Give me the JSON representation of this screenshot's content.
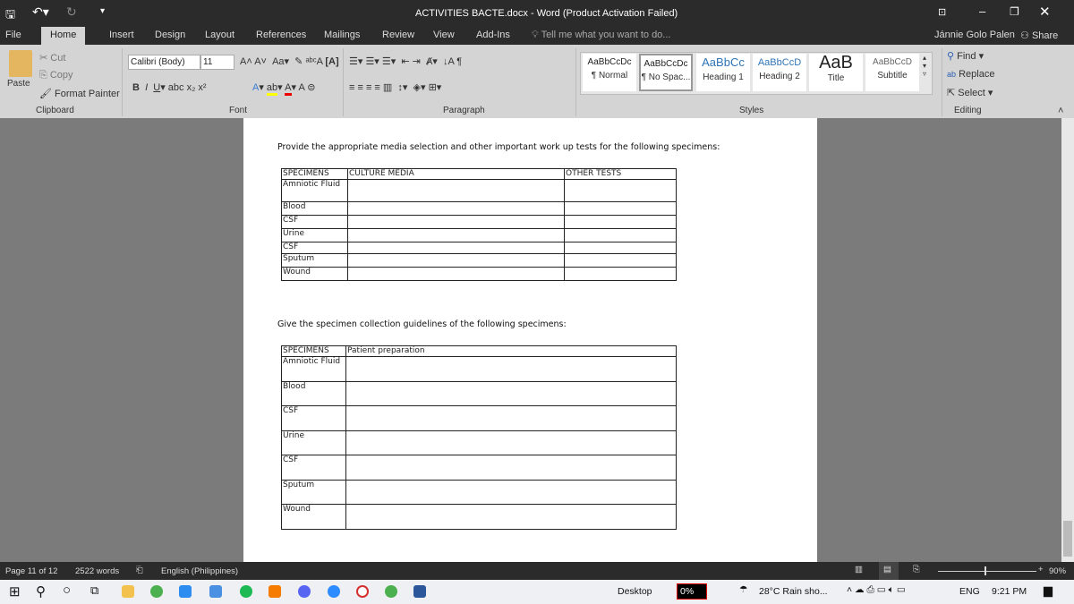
{
  "window": {
    "title": "ACTIVITIES BACTE.docx - Word (Product Activation Failed)",
    "user": "Jánnie Golo Palen",
    "share": "Share"
  },
  "tabs": [
    "File",
    "Home",
    "Insert",
    "Design",
    "Layout",
    "References",
    "Mailings",
    "Review",
    "View",
    "Add-Ins"
  ],
  "tell_me": "Tell me what you want to do...",
  "clipboard": {
    "paste": "Paste",
    "cut": "Cut",
    "copy": "Copy",
    "format_painter": "Format Painter",
    "label": "Clipboard"
  },
  "font": {
    "name": "Calibri (Body)",
    "size": "11",
    "label": "Font"
  },
  "paragraph": {
    "label": "Paragraph"
  },
  "styles": {
    "label": "Styles",
    "items": [
      {
        "preview": "AaBbCcDc",
        "name": "¶ Normal"
      },
      {
        "preview": "AaBbCcDc",
        "name": "¶ No Spac..."
      },
      {
        "preview": "AaBbCc",
        "name": "Heading 1"
      },
      {
        "preview": "AaBbCcD",
        "name": "Heading 2"
      },
      {
        "preview": "AaB",
        "name": "Title"
      },
      {
        "preview": "AaBbCcD",
        "name": "Subtitle"
      }
    ]
  },
  "editing": {
    "find": "Find",
    "replace": "Replace",
    "select": "Select",
    "label": "Editing"
  },
  "document": {
    "q1": "Provide the appropriate media selection and other important work up tests for the following specimens:",
    "t1_headers": [
      "SPECIMENS",
      "CULTURE MEDIA",
      "OTHER TESTS"
    ],
    "t1_rows": [
      "Amniotic Fluid",
      "Blood",
      "CSF",
      "Urine",
      "CSF",
      "Sputum",
      "Wound"
    ],
    "q2": "Give the specimen collection guidelines of the following specimens:",
    "t2_headers": [
      "SPECIMENS",
      "Patient preparation"
    ],
    "t2_rows": [
      "Amniotic Fluid",
      "Blood",
      "CSF",
      "Urine",
      "CSF",
      "Sputum",
      "Wound"
    ]
  },
  "status": {
    "page": "Page 11 of 12",
    "words": "2522 words",
    "language": "English (Philippines)",
    "zoom": "90%"
  },
  "taskbar": {
    "desktop": "Desktop",
    "cpu": "0%",
    "weather": "28°C  Rain sho...",
    "lang": "ENG",
    "time": "9:21 PM"
  }
}
